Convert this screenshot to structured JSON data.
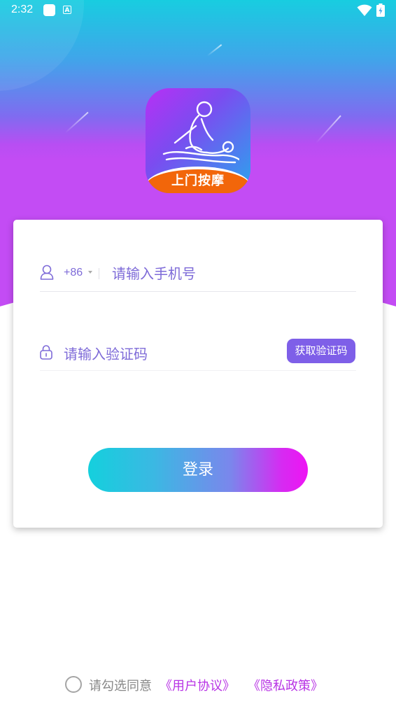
{
  "status_bar": {
    "time": "2:32",
    "notification_letter": "A"
  },
  "logo": {
    "brand_text": "上门按摩"
  },
  "login_form": {
    "country_code": "+86",
    "phone_placeholder": "请输入手机号",
    "code_placeholder": "请输入验证码",
    "get_code_label": "获取验证码",
    "login_label": "登录"
  },
  "agreement": {
    "prompt": "请勾选同意",
    "user_agreement": "《用户协议》",
    "privacy_policy": "《隐私政策》",
    "checked": false
  },
  "colors": {
    "accent_purple": "#7e5fe8",
    "placeholder_purple": "#7e6bd8",
    "link_magenta": "#b833e5",
    "gradient_start": "#14d0dd",
    "gradient_end": "#ee14f4"
  }
}
